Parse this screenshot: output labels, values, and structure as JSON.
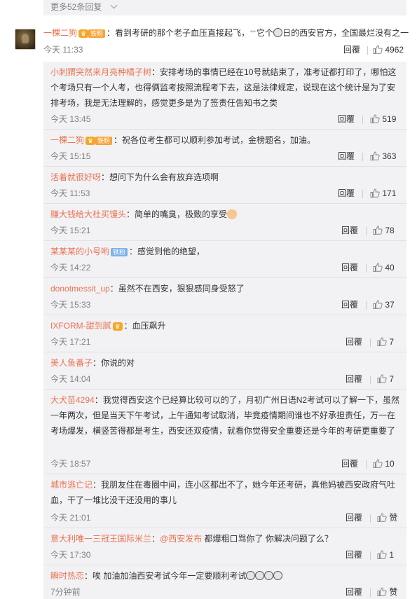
{
  "top": {
    "more_replies": "更多52条回复"
  },
  "main_comment": {
    "user": "一棵二狗",
    "badge": "铁粉",
    "text_a": "：看到考研的那个老子血压直接起飞，",
    "text_b": "它个",
    "text_c": "日的西安官方，全国最烂没有之一",
    "time": "今天 11:33",
    "reply_label": "回覆",
    "likes": "4962"
  },
  "replies": [
    {
      "user": "小刺猬突然来月亮种橘子树",
      "text": "：安排考场的事情已经在10号就结束了，准考证都打印了，哪怕这个考场只有一个人考，也得俩监考按照流程考下去，这是法律规定，说现在这个统计是为了安排考场，我是无法理解的，感觉更多是为了签责任告知书之类",
      "time": "今天 13:45",
      "reply_label": "回覆",
      "likes": "519"
    },
    {
      "user": "一棵二狗",
      "badge": "铁粉",
      "text": "：祝各位考生都可以顺利参加考试，金榜题名，加油。",
      "time": "今天 15:15",
      "reply_label": "回覆",
      "likes": "363"
    },
    {
      "user": "活着就很好呀",
      "text": "：想问下为什么会有放弃选项啊",
      "time": "今天 11:53",
      "reply_label": "回覆",
      "likes": "171"
    },
    {
      "user": "赚大钱给大杜买馒头",
      "text": "：简单的嘴臭，极致的享受",
      "time": "今天 15:21",
      "reply_label": "回覆",
      "likes": "78"
    },
    {
      "user": "某某某的小号哟",
      "badge": "铁粉",
      "text": "：感觉到他的绝望，",
      "time": "今天 14:22",
      "reply_label": "回覆",
      "likes": "40"
    },
    {
      "user": "donotmessit_up",
      "text": "：虽然不在西安，狠狠感同身受怒了",
      "time": "今天 15:33",
      "reply_label": "回覆",
      "likes": "37"
    },
    {
      "user": "IXFORM-甜到腻",
      "text": "：血压飙升",
      "time": "今天 17:21",
      "reply_label": "回覆",
      "likes": "7"
    },
    {
      "user": "美人鱼番子",
      "text": "：你说的对",
      "time": "今天 14:04",
      "reply_label": "回覆",
      "likes": "7"
    },
    {
      "user": "大犬苗4294",
      "text": "：我觉得西安这个已经算比较可以的了，月初广州日语N2考试可以了解一下，虽然一年两次，但是当天下午考试，上午通知考试取消，毕竟疫情期间谁也不好承担责任，万一在考场爆发，横竖苦得都是考生，西安还双疫情，就看你觉得安全重要还是今年的考研更重要了",
      "time": "今天 18:57",
      "reply_label": "回覆",
      "likes": "10"
    },
    {
      "user": "城市逃亡记",
      "text": "：我朋友住在毒圈中间，连小区都出不了，她今年还考研，真他妈被西安政府气吐血，干了一堆比没干还没用的事儿",
      "time": "今天 21:01",
      "reply_label": "回覆",
      "likes": "赞"
    },
    {
      "user": "意大利唯一三冠王国际米兰",
      "text_pre": "：",
      "mention": "@西安发布",
      "text": " 都爆粗口骂你了 你解决问题了么？",
      "time": "今天 17:30",
      "reply_label": "回覆",
      "likes": "1"
    },
    {
      "user": "瞬时热恋",
      "text": "：唉 加油加油西安考试今年一定要顺利考试",
      "time": "7分钟前",
      "reply_label": "回覆",
      "likes": "赞"
    }
  ],
  "colors": {
    "username": "#eb7350",
    "reply_bg": "#f2f2f5",
    "time": "#808080"
  },
  "icons": [
    "chevron-down-icon",
    "crown-icon",
    "thumb-up-icon",
    "emoji-icon"
  ]
}
